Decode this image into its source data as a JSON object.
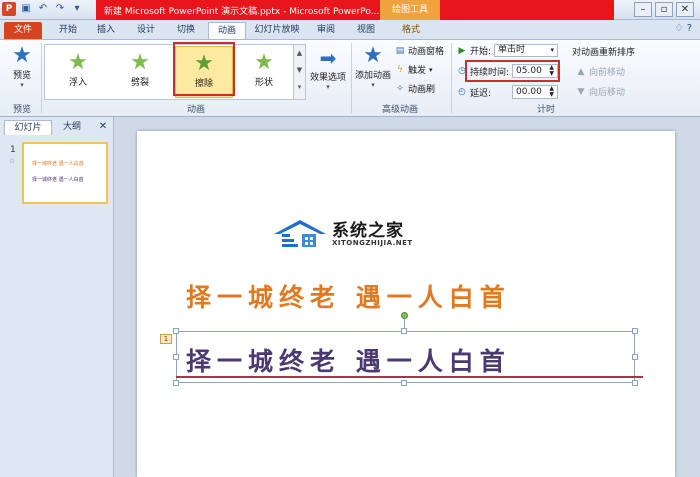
{
  "titlebar": {
    "title": "新建 Microsoft PowerPoint 演示文稿.pptx - Microsoft PowerPo...",
    "tool_badge": "绘图工具",
    "qat_icons": [
      "ppt-icon",
      "save-icon",
      "undo-icon",
      "redo-icon",
      "customize-icon"
    ],
    "window_controls": [
      "minimize-icon",
      "restore-icon",
      "close-icon"
    ]
  },
  "tabs": {
    "file": "文件",
    "items": [
      "开始",
      "插入",
      "设计",
      "切换",
      "动画",
      "幻灯片放映",
      "审阅",
      "视图",
      "格式"
    ],
    "active": "动画"
  },
  "ribbon": {
    "preview": {
      "label": "预览",
      "group": "预览"
    },
    "animation_gallery": {
      "items": [
        {
          "label": "浮入",
          "selected": false
        },
        {
          "label": "劈裂",
          "selected": false
        },
        {
          "label": "擦除",
          "selected": true
        },
        {
          "label": "形状",
          "selected": false
        }
      ],
      "effect_options": "效果选项",
      "group": "动画"
    },
    "advanced": {
      "add_animation": "添加动画",
      "animation_pane": "动画窗格",
      "trigger": "触发",
      "animation_painter": "动画刷",
      "group": "高级动画"
    },
    "timing": {
      "start_label": "开始:",
      "start_value": "单击时",
      "duration_label": "持续时间:",
      "duration_value": "05.00",
      "delay_label": "延迟:",
      "delay_value": "00.00",
      "reorder_title": "对动画重新排序",
      "move_earlier": "向前移动",
      "move_later": "向后移动",
      "group": "计时"
    },
    "accent_highlight": "#c9302c"
  },
  "left_pane": {
    "tabs": [
      "幻灯片",
      "大纲"
    ],
    "slide_number": "1",
    "thumb_line1": "择一城终老  遇一人白首",
    "thumb_line2": "择一城终老  遇一人白首"
  },
  "slide": {
    "line1": "择一城终老    遇一人白首",
    "line2": "择一城终老    遇一人白首",
    "animation_tag": "1",
    "watermark_cn": "系统之家",
    "watermark_en": "XITONGZHIJIA.NET",
    "orange": "#e07a22",
    "purple": "#4b3a72"
  }
}
